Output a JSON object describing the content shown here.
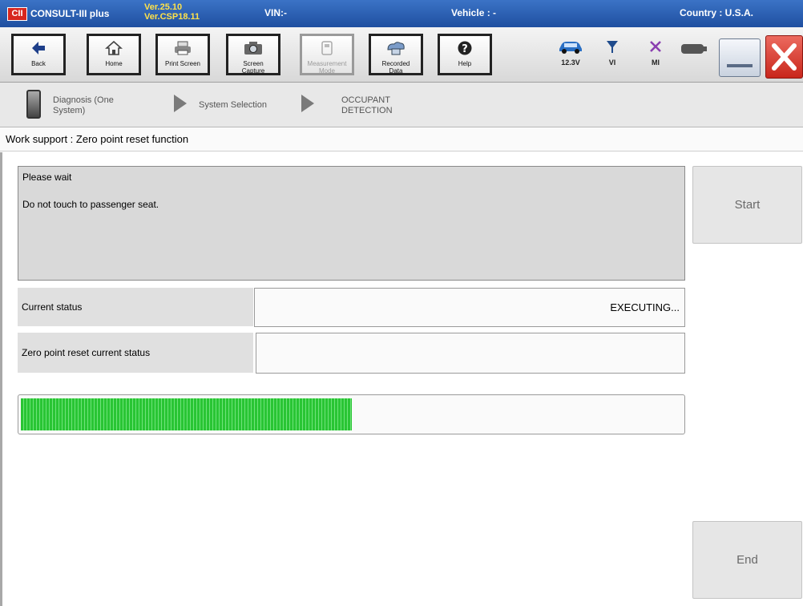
{
  "titlebar": {
    "logo": "CII",
    "app_name": "CONSULT-III plus",
    "version_1": "Ver.25.10",
    "version_2": "Ver.CSP18.11",
    "vin": "VIN:-",
    "vehicle": "Vehicle : -",
    "country": "Country : U.S.A."
  },
  "toolbar": {
    "back": "Back",
    "home": "Home",
    "print_screen": "Print Screen",
    "screen_capture_1": "Screen",
    "screen_capture_2": "Capture",
    "measurement_1": "Measurement",
    "measurement_2": "Mode",
    "recorded_1": "Recorded",
    "recorded_2": "Data",
    "help": "Help",
    "voltage": "12.3V",
    "vi": "VI",
    "mi": "MI"
  },
  "breadcrumb": {
    "item1_line1": "Diagnosis (One",
    "item1_line2": "System)",
    "item2": "System Selection",
    "item3_line1": "OCCUPANT",
    "item3_line2": "DETECTION"
  },
  "page": {
    "title": "Work support : Zero point reset function"
  },
  "message": {
    "line1": "Please  wait",
    "line2": "Do not touch to passenger seat."
  },
  "status": {
    "current_label": "Current status",
    "current_value": "EXECUTING...",
    "zero_label": "Zero point reset current status",
    "zero_value": ""
  },
  "progress": {
    "percent": 50
  },
  "buttons": {
    "start": "Start",
    "end": "End"
  },
  "colors": {
    "titlebar": "#2a5fb4",
    "progress": "#29c534",
    "close": "#d9362b"
  }
}
